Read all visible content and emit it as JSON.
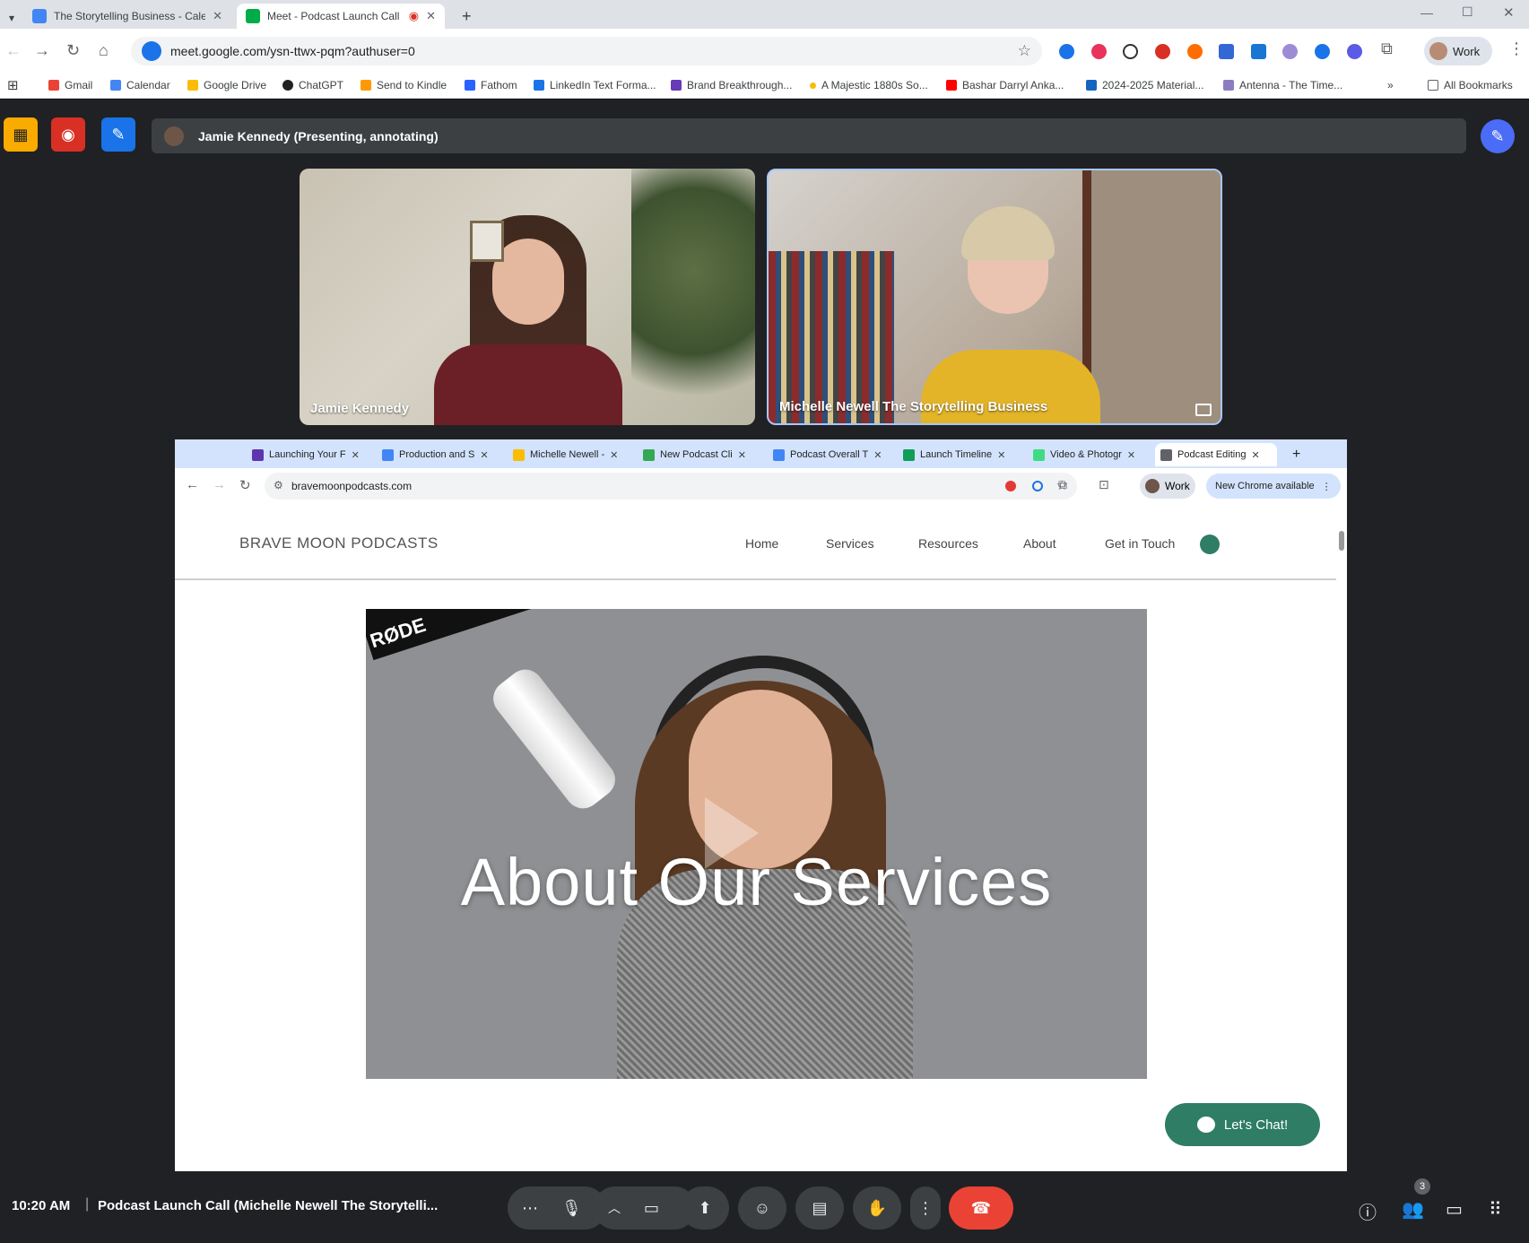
{
  "outer_browser": {
    "tabs": [
      {
        "label": "The Storytelling Business - Cale",
        "active": false
      },
      {
        "label": "Meet - Podcast Launch Call",
        "active": true
      }
    ],
    "url": "meet.google.com/ysn-ttwx-pqm?authuser=0",
    "profile_label": "Work",
    "bookmarks": [
      "Gmail",
      "Calendar",
      "Google Drive",
      "ChatGPT",
      "Send to Kindle",
      "Fathom",
      "LinkedIn Text Forma...",
      "Brand Breakthrough...",
      "A Majestic 1880s So...",
      "Bashar Darryl Anka...",
      "2024-2025 Material...",
      "Antenna - The Time..."
    ],
    "all_bookmarks": "All Bookmarks"
  },
  "meet": {
    "presenter_bar": "Jamie Kennedy (Presenting, annotating)",
    "participants": [
      {
        "name": "Jamie Kennedy"
      },
      {
        "name": "Michelle Newell The Storytelling Business"
      }
    ],
    "clock": "10:20 AM",
    "meeting_title": "Podcast Launch Call (Michelle Newell The Storytelli...",
    "people_count": "3"
  },
  "shared": {
    "tabs": [
      {
        "label": "Launching Your F",
        "color": "#5e35b1"
      },
      {
        "label": "Production and S",
        "color": "#4285f4"
      },
      {
        "label": "Michelle Newell -",
        "color": "#fbbc04"
      },
      {
        "label": "New Podcast Cli",
        "color": "#34a853"
      },
      {
        "label": "Podcast Overall T",
        "color": "#4285f4"
      },
      {
        "label": "Launch Timeline",
        "color": "#0f9d58"
      },
      {
        "label": "Video & Photogr",
        "color": "#3ddc84"
      },
      {
        "label": "Podcast Editing",
        "color": "#5f6368"
      }
    ],
    "url": "bravemoonpodcasts.com",
    "profile_label": "Work",
    "chrome_update": "New Chrome available",
    "site": {
      "logo": "BRAVE MOON PODCASTS",
      "nav": [
        "Home",
        "Services",
        "Resources",
        "About",
        "Get in Touch"
      ],
      "hero_title": "About Our Services",
      "mic_brand": "RØDE",
      "chat_button": "Let's Chat!"
    }
  },
  "colors": {
    "meet_bg": "#202124",
    "end_call": "#ea4335",
    "chat_green": "#2e7d64"
  }
}
